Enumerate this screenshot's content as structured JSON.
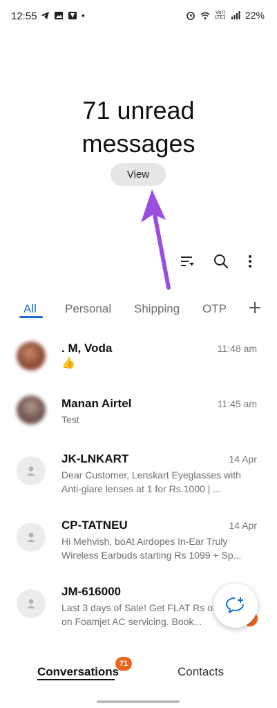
{
  "status_bar": {
    "time": "12:55",
    "dot": "•",
    "battery": "22%",
    "volte": "Vo))",
    "lte": "LTE1",
    "left_icons": [
      "telegram-icon",
      "gallery-icon",
      "image-icon"
    ],
    "right_icons": [
      "alarm-icon",
      "wifi-icon",
      "signal-icon"
    ]
  },
  "header": {
    "title_line1": "71 unread",
    "title_line2": "messages",
    "view_label": "View"
  },
  "toolbar": {
    "icons": [
      "filter-icon",
      "search-icon",
      "more-vert-icon"
    ]
  },
  "tabs": [
    {
      "label": "All",
      "active": true
    },
    {
      "label": "Personal",
      "active": false
    },
    {
      "label": "Shipping",
      "active": false
    },
    {
      "label": "OTP",
      "active": false
    }
  ],
  "conversations": [
    {
      "name": ". M, Voda",
      "time": "11:48 am",
      "preview": "👍",
      "avatar": "photo",
      "avatar_color": "#a05a3c"
    },
    {
      "name": "Manan Airtel",
      "time": "11:45 am",
      "preview": "Test",
      "avatar": "photo",
      "avatar_color": "#7a5a56"
    },
    {
      "name": "JK-LNKART",
      "time": "14 Apr",
      "preview": "Dear Customer, Lenskart Eyeglasses with Anti-glare lenses at 1 for Rs.1000 | ...",
      "avatar": "blank"
    },
    {
      "name": "CP-TATNEU",
      "time": "14 Apr",
      "preview": "Hi Mehvish, boAt Airdopes In-Ear Truly Wireless Earbuds starting Rs 1099 + Sp...",
      "avatar": "blank"
    },
    {
      "name": "JM-616000",
      "time": "",
      "preview": "Last 3 days of Sale! Get FLAT Rs off on Foamjet AC servicing. Book...",
      "avatar": "blank"
    }
  ],
  "fab": {
    "icon": "new-message-icon"
  },
  "bottom_nav": {
    "conversations_label": "Conversations",
    "conversations_badge": "71",
    "contacts_label": "Contacts"
  },
  "colors": {
    "accent": "#1a6bd1",
    "badge": "#e8651b",
    "annotation_arrow": "#9a4ee0"
  }
}
